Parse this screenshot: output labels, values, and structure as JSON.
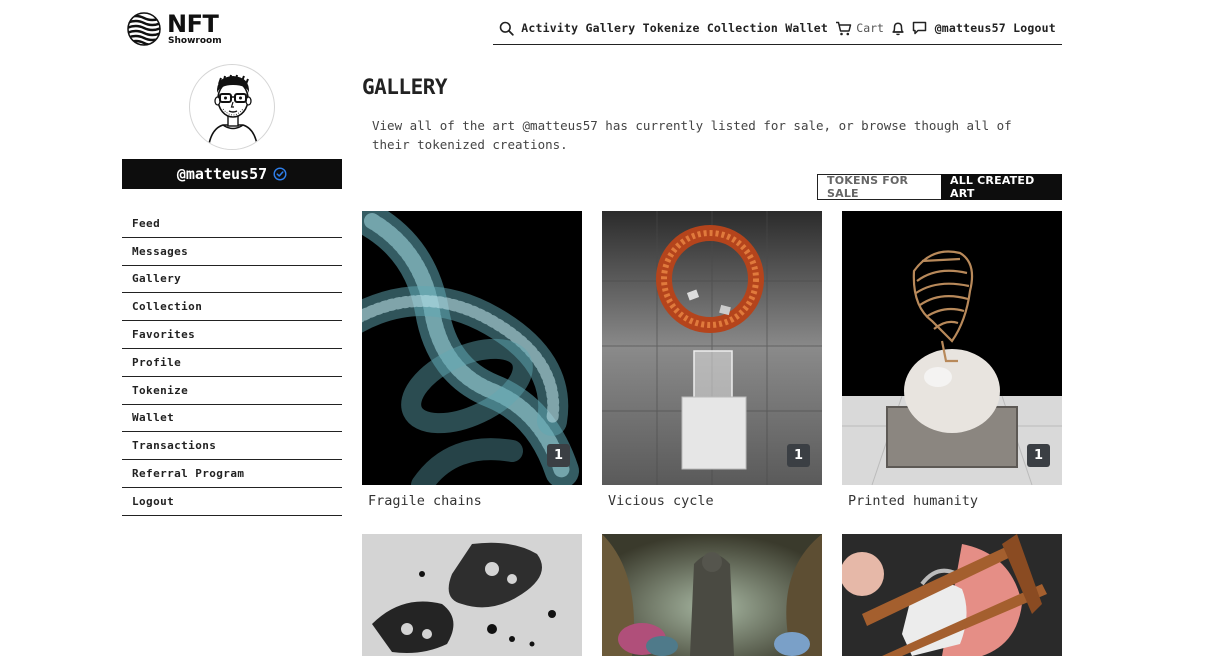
{
  "brand": {
    "name": "NFT",
    "sub": "Showroom"
  },
  "topnav": {
    "items": [
      "Activity",
      "Gallery",
      "Tokenize",
      "Collection",
      "Wallet"
    ],
    "cart_label": "Cart",
    "user_label": "@matteus57",
    "logout_label": "Logout"
  },
  "profile": {
    "username": "@matteus57",
    "verified": true
  },
  "sidebar": {
    "items": [
      {
        "label": "Feed"
      },
      {
        "label": "Messages"
      },
      {
        "label": "Gallery"
      },
      {
        "label": "Collection"
      },
      {
        "label": "Favorites"
      },
      {
        "label": "Profile"
      },
      {
        "label": "Tokenize"
      },
      {
        "label": "Wallet"
      },
      {
        "label": "Transactions"
      },
      {
        "label": "Referral Program"
      },
      {
        "label": "Logout"
      }
    ]
  },
  "main": {
    "title": "GALLERY",
    "intro": "View all of the art @matteus57 has currently listed for sale, or browse though all of their tokenized creations.",
    "toggle": {
      "tokens_for_sale": "TOKENS FOR SALE",
      "all_created_art": "ALL CREATED ART",
      "active": "all_created_art"
    },
    "cards": [
      {
        "title": "Fragile chains",
        "count": "1"
      },
      {
        "title": "Vicious cycle",
        "count": "1"
      },
      {
        "title": "Printed humanity",
        "count": "1"
      },
      {
        "title": ""
      },
      {
        "title": ""
      },
      {
        "title": ""
      }
    ]
  },
  "colors": {
    "ink": "#222222",
    "black_bar": "#0d0d0d",
    "badge": "#3b3f44",
    "verified": "#2f80ed"
  },
  "icons": [
    "search-icon",
    "cart-icon",
    "bell-icon",
    "chat-icon",
    "verified-check-icon"
  ]
}
